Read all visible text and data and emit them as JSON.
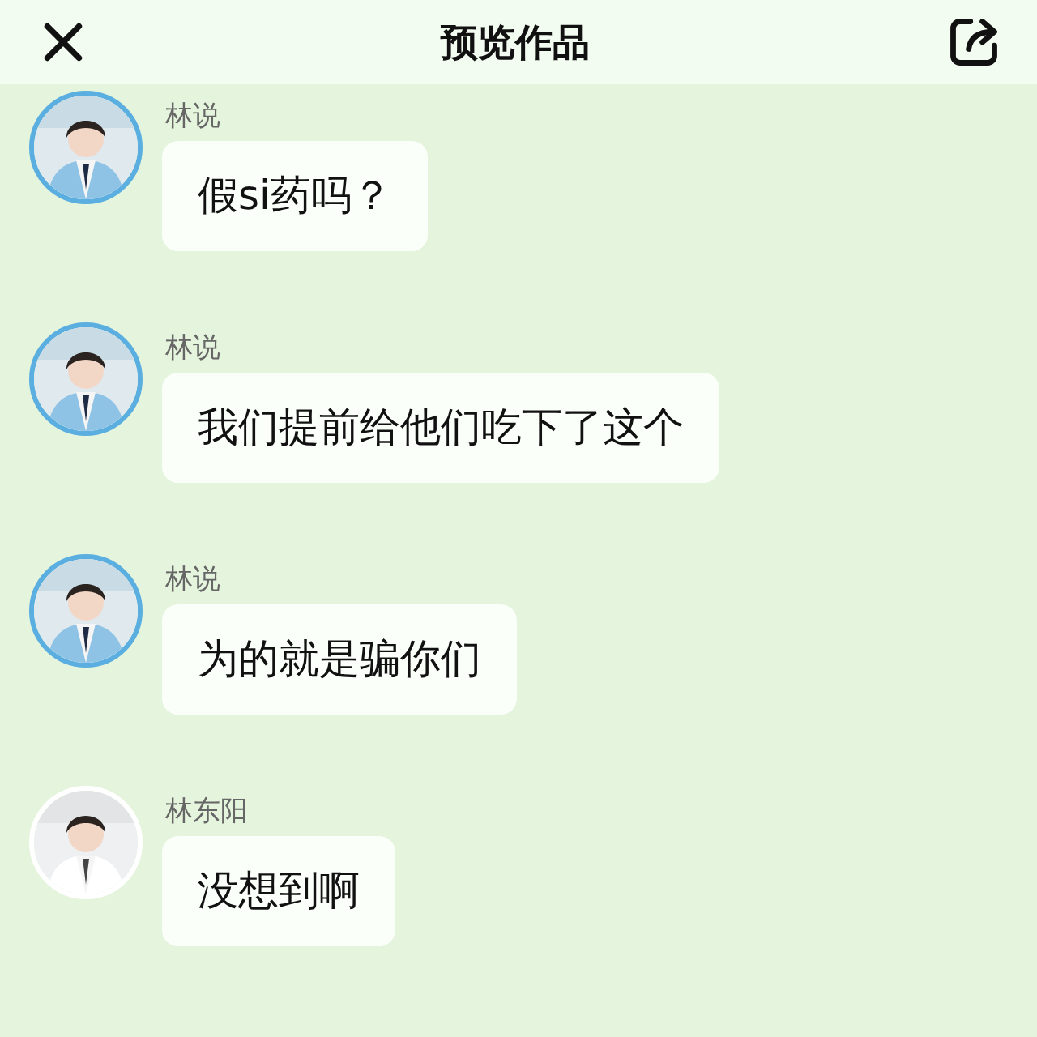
{
  "header": {
    "title": "预览作品"
  },
  "messages": [
    {
      "name": "林说",
      "text": "假si药吗？"
    },
    {
      "name": "林说",
      "text": "我们提前给他们吃下了这个"
    },
    {
      "name": "林说",
      "text": "为的就是骗你们"
    },
    {
      "name": "林东阳",
      "text": "没想到啊"
    }
  ]
}
